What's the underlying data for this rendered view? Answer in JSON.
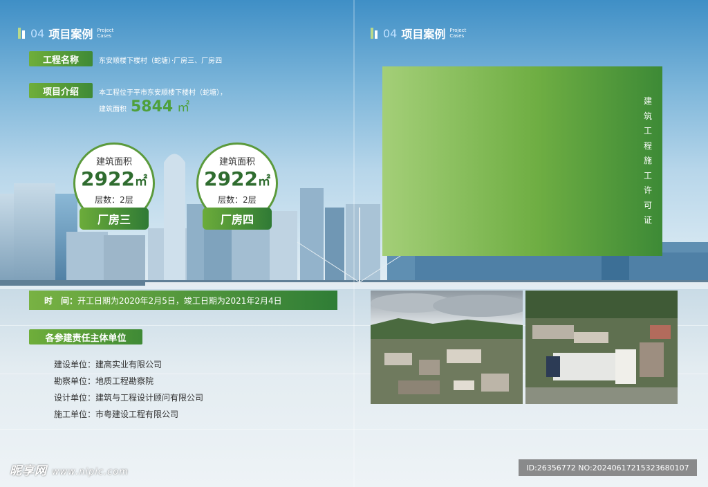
{
  "left_section": {
    "number": "04",
    "title": "项目案例",
    "en_line1": "Project",
    "en_line2": "Cases"
  },
  "right_section": {
    "number": "04",
    "title": "项目案例",
    "en_line1": "Project",
    "en_line2": "Cases"
  },
  "project_name": {
    "label": "工程名称",
    "value": "东安顺楼下楼村（蛇塘）·厂房三、厂房四"
  },
  "project_intro": {
    "label": "项目介绍",
    "line1": "本工程位于平市东安顺楼下楼村（蛇塘），",
    "area_label": "建筑面积",
    "area_value": "5844",
    "area_unit": "㎡"
  },
  "buildings": [
    {
      "area_title": "建筑面积",
      "area": "2922",
      "unit": "㎡",
      "floors": "层数：2层",
      "name": "厂房三"
    },
    {
      "area_title": "建筑面积",
      "area": "2922",
      "unit": "㎡",
      "floors": "层数：2层",
      "name": "厂房四"
    }
  ],
  "time": {
    "label": "时　间：",
    "value": "开工日期为2020年2月5日，竣工日期为2021年2月4日"
  },
  "units": {
    "label": "各参建责任主体单位",
    "rows": [
      {
        "k": "建设单位：",
        "v": "建高实业有限公司"
      },
      {
        "k": "勘察单位：",
        "v": "地质工程勘察院"
      },
      {
        "k": "设计单位：",
        "v": "建筑与工程设计顾问有限公司"
      },
      {
        "k": "施工单位：",
        "v": "市粤建设工程有限公司"
      }
    ]
  },
  "permit": {
    "vertical_text": [
      "建",
      "筑",
      "工",
      "程",
      "施",
      "工",
      "许",
      "可",
      "证"
    ]
  },
  "footer": {
    "watermark": "昵享网",
    "site": "www.nipic.com",
    "id_text": "ID:26356772 NO:20240617215323680107"
  },
  "colors": {
    "green_dark": "#2f7a35",
    "green_light": "#78b243",
    "sky": "#3f8fc6"
  }
}
